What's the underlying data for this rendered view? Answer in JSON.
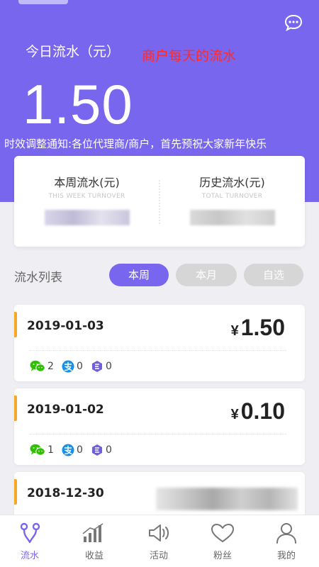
{
  "header": {
    "title": "今日流水（元）",
    "annotation": "商户每天的流水",
    "today_amount": "1.50",
    "ticker": "时效调整通知:各位代理商/商户，首先预祝大家新年快乐"
  },
  "summary": {
    "week_title": "本周流水(元)",
    "week_sub": "THIS WEEK TURNOVER",
    "history_title": "历史流水(元)",
    "history_sub": "TOTAL TURNOVER"
  },
  "list": {
    "title": "流水列表",
    "tabs": {
      "week": "本周",
      "month": "本月",
      "custom": "自选"
    },
    "records": [
      {
        "date": "2019-01-03",
        "currency": "¥",
        "amount": "1.50",
        "wechat": "2",
        "alipay": "0",
        "other": "0"
      },
      {
        "date": "2019-01-02",
        "currency": "¥",
        "amount": "0.10",
        "wechat": "1",
        "alipay": "0",
        "other": "0"
      },
      {
        "date": "2018-12-30"
      }
    ]
  },
  "tabbar": {
    "items": [
      {
        "label": "流水",
        "icon": "flow-icon",
        "active": true
      },
      {
        "label": "收益",
        "icon": "bar-chart-icon"
      },
      {
        "label": "活动",
        "icon": "speaker-icon"
      },
      {
        "label": "粉丝",
        "icon": "heart-icon"
      },
      {
        "label": "我的",
        "icon": "user-icon"
      }
    ]
  },
  "colors": {
    "primary": "#7866ee",
    "accent": "#f3a82a",
    "wechat": "#2dc100",
    "alipay": "#1a8fe3",
    "other": "#6f5fd8",
    "annotation": "#ff2a2a"
  }
}
